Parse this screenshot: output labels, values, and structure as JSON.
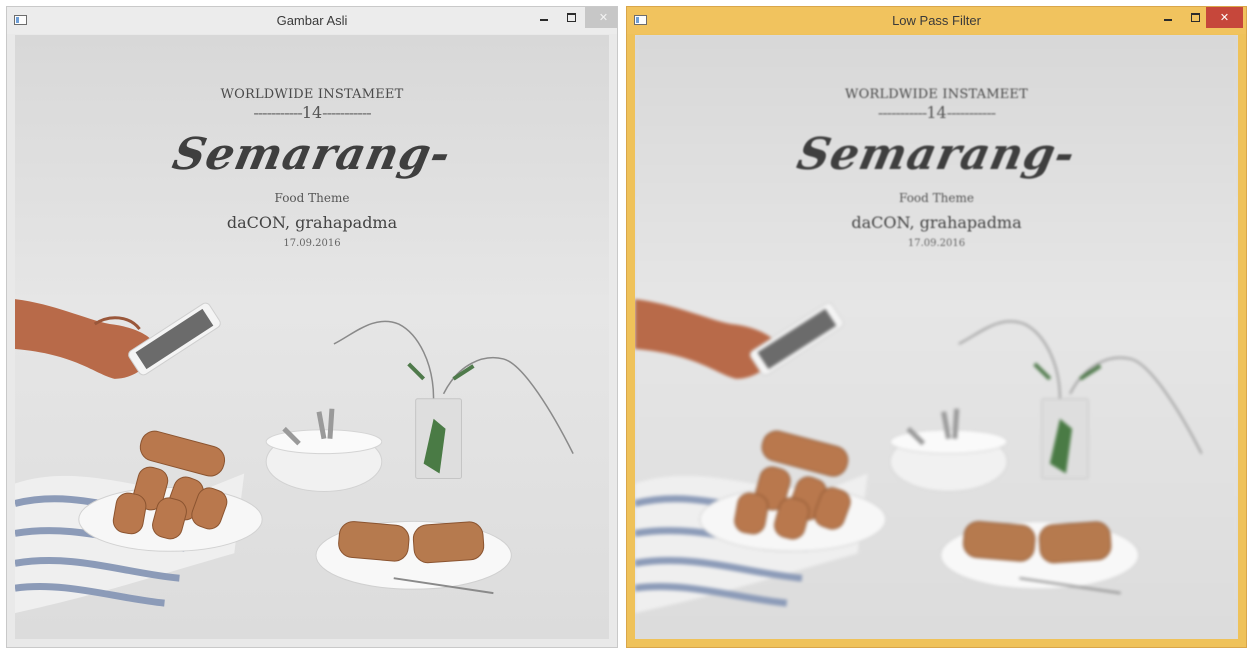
{
  "windows": [
    {
      "title": "Gambar Asli",
      "state": "inactive",
      "controls": {
        "minimize": "minimize-icon",
        "maximize": "maximize-icon",
        "close": "close-icon"
      }
    },
    {
      "title": "Low Pass Filter",
      "state": "active",
      "controls": {
        "minimize": "minimize-icon",
        "maximize": "maximize-icon",
        "close": "close-icon"
      }
    }
  ],
  "poster": {
    "line1": "WORLDWIDE INSTAMEET",
    "number": "14",
    "dashes": "-----------",
    "city": "Semarang-",
    "theme": "Food Theme",
    "venue": "daCON, grahapadma",
    "date": "17.09.2016"
  },
  "colors": {
    "active_frame": "#efc25a",
    "inactive_frame": "#e9e9e9",
    "close_active": "#c6473b"
  }
}
